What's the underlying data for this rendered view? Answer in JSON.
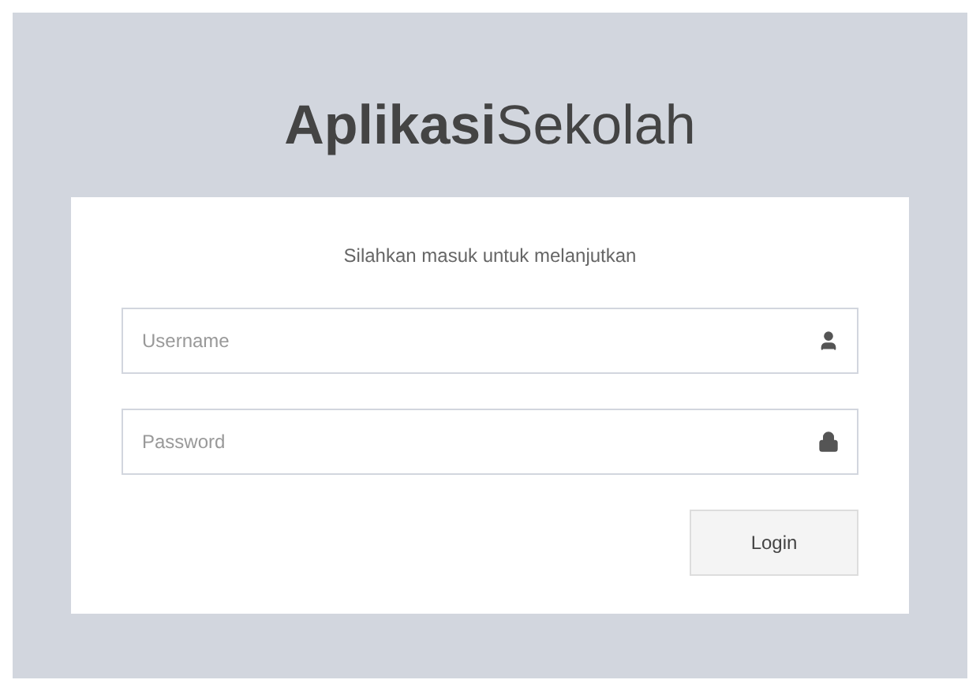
{
  "logo": "**Aplikasi**Sekolah",
  "login_box": {
    "message": "Silahkan masuk untuk melanjutkan",
    "fields": [
      {
        "kind": "username",
        "placeholder": "Username"
      },
      {
        "kind": "password",
        "placeholder": "Password"
      }
    ],
    "button": "Login"
  }
}
